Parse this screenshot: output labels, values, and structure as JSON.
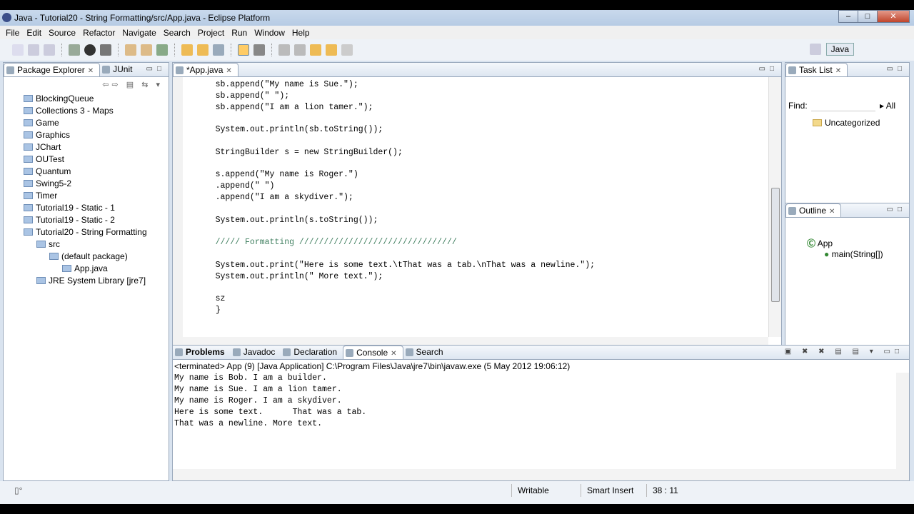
{
  "window": {
    "title": "Java - Tutorial20 - String Formatting/src/App.java - Eclipse Platform"
  },
  "menu": [
    "File",
    "Edit",
    "Source",
    "Refactor",
    "Navigate",
    "Search",
    "Project",
    "Run",
    "Window",
    "Help"
  ],
  "perspective": {
    "label": "Java"
  },
  "package_explorer": {
    "tabs": [
      "Package Explorer",
      "JUnit"
    ],
    "items": [
      {
        "label": "BlockingQueue",
        "level": 0
      },
      {
        "label": "Collections 3 - Maps",
        "level": 0
      },
      {
        "label": "Game",
        "level": 0
      },
      {
        "label": "Graphics",
        "level": 0
      },
      {
        "label": "JChart",
        "level": 0
      },
      {
        "label": "OUTest",
        "level": 0
      },
      {
        "label": "Quantum",
        "level": 0
      },
      {
        "label": "Swing5-2",
        "level": 0
      },
      {
        "label": "Timer",
        "level": 0
      },
      {
        "label": "Tutorial19 - Static - 1",
        "level": 0
      },
      {
        "label": "Tutorial19 - Static - 2",
        "level": 0
      },
      {
        "label": "Tutorial20 - String Formatting",
        "level": 0
      },
      {
        "label": "src",
        "level": 1
      },
      {
        "label": "(default package)",
        "level": 2
      },
      {
        "label": "App.java",
        "level": 3
      },
      {
        "label": "JRE System Library [jre7]",
        "level": 1
      }
    ]
  },
  "editor": {
    "tab": "*App.java",
    "lines": [
      "    sb.append(\"My name is Sue.\");",
      "    sb.append(\" \");",
      "    sb.append(\"I am a lion tamer.\");",
      "",
      "    System.out.println(sb.toString());",
      "",
      "    StringBuilder s = new StringBuilder();",
      "",
      "    s.append(\"My name is Roger.\")",
      "    .append(\" \")",
      "    .append(\"I am a skydiver.\");",
      "",
      "    System.out.println(s.toString());",
      "",
      "    ///// Formatting ////////////////////////////////",
      "",
      "    System.out.print(\"Here is some text.\\tThat was a tab.\\nThat was a newline.\");",
      "    System.out.println(\" More text.\");",
      "",
      "    sz",
      "}"
    ]
  },
  "task_list": {
    "tab": "Task List",
    "find_label": "Find:",
    "all_label": "All",
    "category": "Uncategorized"
  },
  "outline": {
    "tab": "Outline",
    "class": "App",
    "method": "main(String[])"
  },
  "bottom": {
    "tabs": [
      "Problems",
      "Javadoc",
      "Declaration",
      "Console",
      "Search"
    ],
    "console_header": "<terminated> App (9) [Java Application] C:\\Program Files\\Java\\jre7\\bin\\javaw.exe (5 May 2012 19:06:12)",
    "output": [
      "My name is Bob. I am a builder.",
      "My name is Sue. I am a lion tamer.",
      "My name is Roger. I am a skydiver.",
      "Here is some text.\tThat was a tab.",
      "That was a newline. More text."
    ]
  },
  "status": {
    "writable": "Writable",
    "insert_mode": "Smart Insert",
    "position": "38 : 11"
  }
}
